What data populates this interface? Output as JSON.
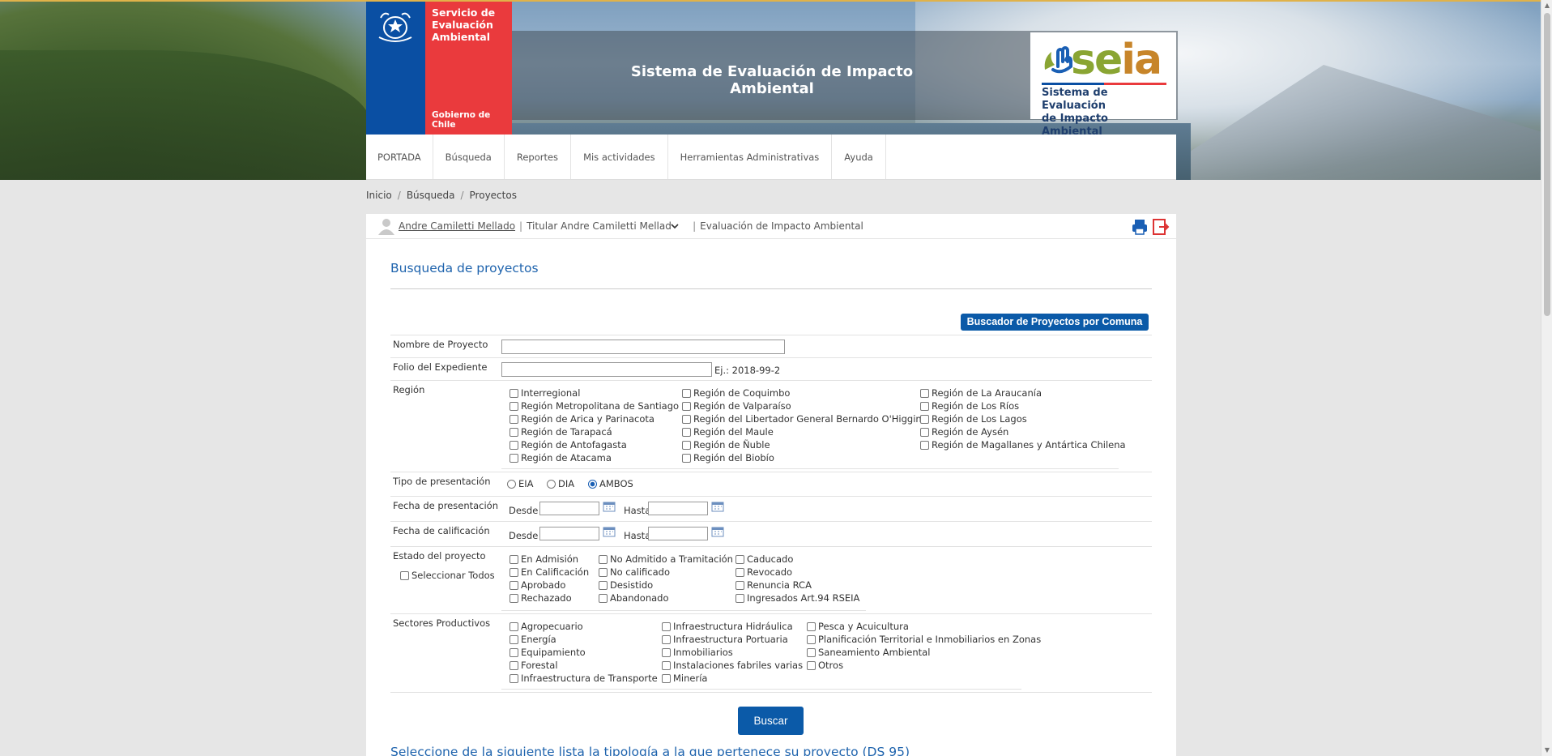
{
  "header": {
    "gob_title": "Servicio de Evaluación Ambiental",
    "gob_title_l1": "Servicio de",
    "gob_title_l2": "Evaluación",
    "gob_title_l3": "Ambiental",
    "gob_footer": "Gobierno de Chile",
    "banner_title": "Sistema de Evaluación de Impacto Ambiental",
    "seia_word_a": "se",
    "seia_word_b": "ia",
    "seia_sub_l1": "Sistema de Evaluación",
    "seia_sub_l2": "de Impacto Ambiental"
  },
  "nav": [
    "PORTADA",
    "Búsqueda",
    "Reportes",
    "Mis actividades",
    "Herramientas Administrativas",
    "Ayuda"
  ],
  "breadcrumb": [
    "Inicio",
    "Búsqueda",
    "Proyectos"
  ],
  "userbar": {
    "user": "Andre Camiletti Mellado",
    "role": "Titular Andre Camiletti Mellado",
    "context": "Evaluación de Impacto Ambiental"
  },
  "search": {
    "title": "Busqueda de proyectos",
    "comuna_button": "Buscador de Proyectos por Comuna",
    "nombre_label": "Nombre de Proyecto",
    "nombre_value": "",
    "folio_label": "Folio del Expediente",
    "folio_value": "",
    "folio_hint": "Ej.: 2018-99-2",
    "region_label": "Región",
    "regions_col1": [
      "Interregional",
      "Región Metropolitana de Santiago",
      "Región de Arica y Parinacota",
      "Región de Tarapacá",
      "Región de Antofagasta",
      "Región de Atacama"
    ],
    "regions_col2": [
      "Región de Coquimbo",
      "Región de Valparaíso",
      "Región del Libertador General Bernardo O'Higgins",
      "Región del Maule",
      "Región de Ñuble",
      "Región del Biobío"
    ],
    "regions_col3": [
      "Región de La Araucanía",
      "Región de Los Ríos",
      "Región de Los Lagos",
      "Región de Aysén",
      "Región de Magallanes y Antártica Chilena"
    ],
    "tipo_label": "Tipo de presentación",
    "tipo_options": [
      "EIA",
      "DIA",
      "AMBOS"
    ],
    "tipo_selected": "AMBOS",
    "fecha_pres_label": "Fecha de presentación",
    "fecha_calif_label": "Fecha de calificación",
    "desde": "Desde",
    "hasta": "Hasta",
    "estado_label": "Estado del proyecto",
    "select_all": "Seleccionar Todos",
    "estado_col1": [
      "En Admisión",
      "En Calificación",
      "Aprobado",
      "Rechazado"
    ],
    "estado_col2": [
      "No Admitido a Tramitación",
      "No calificado",
      "Desistido",
      "Abandonado"
    ],
    "estado_col3": [
      "Caducado",
      "Revocado",
      "Renuncia RCA",
      "Ingresados Art.94 RSEIA"
    ],
    "sectores_label": "Sectores Productivos",
    "sectores_col1": [
      "Agropecuario",
      "Energía",
      "Equipamiento",
      "Forestal",
      "Infraestructura de Transporte"
    ],
    "sectores_col2": [
      "Infraestructura Hidráulica",
      "Infraestructura Portuaria",
      "Inmobiliarios",
      "Instalaciones fabriles varias",
      "Minería"
    ],
    "sectores_col3": [
      "Pesca y Acuicultura",
      "Planificación Territorial e Inmobiliarios en Zonas",
      "Saneamiento Ambiental",
      "Otros"
    ],
    "buscar_button": "Buscar",
    "bottom_title": "Seleccione de la siguiente lista la tipología a la que pertenece su proyecto (DS 95)"
  },
  "colors": {
    "accent": "#1e63ad",
    "button": "#0b5aa8",
    "gob_blue": "#0a4fa3",
    "gob_red": "#ea3a3d"
  }
}
